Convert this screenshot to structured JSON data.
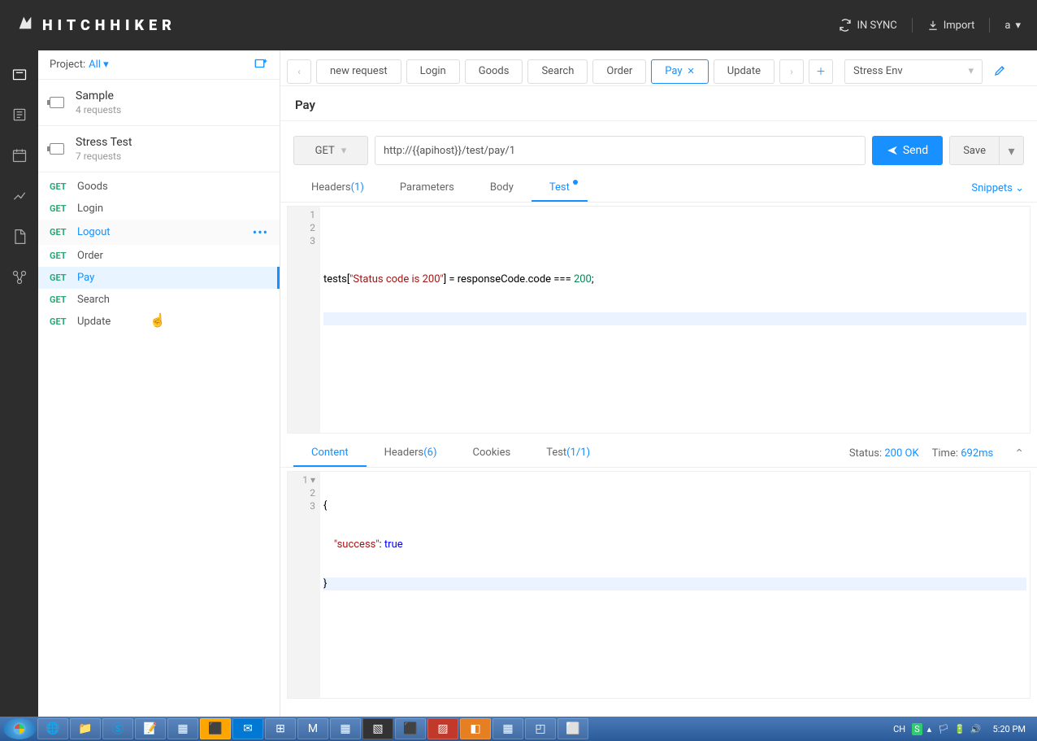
{
  "header": {
    "brand": "HITCHHIKER",
    "sync": "IN SYNC",
    "import": "Import",
    "user": "a"
  },
  "sidebar": {
    "project_label": "Project:",
    "project_value": "All",
    "collections": [
      {
        "name": "Sample",
        "count": "4 requests"
      },
      {
        "name": "Stress Test",
        "count": "7 requests"
      }
    ],
    "requests": [
      {
        "method": "GET",
        "name": "Goods"
      },
      {
        "method": "GET",
        "name": "Login"
      },
      {
        "method": "GET",
        "name": "Logout",
        "hovered": true
      },
      {
        "method": "GET",
        "name": "Order"
      },
      {
        "method": "GET",
        "name": "Pay",
        "active": true
      },
      {
        "method": "GET",
        "name": "Search"
      },
      {
        "method": "GET",
        "name": "Update"
      }
    ]
  },
  "tabs": {
    "items": [
      {
        "label": "new request"
      },
      {
        "label": "Login"
      },
      {
        "label": "Goods"
      },
      {
        "label": "Search"
      },
      {
        "label": "Order"
      },
      {
        "label": "Pay",
        "active": true,
        "closable": true
      },
      {
        "label": "Update"
      }
    ],
    "env": "Stress Env"
  },
  "request": {
    "title": "Pay",
    "method": "GET",
    "url": "http://{{apihost}}/test/pay/1",
    "send": "Send",
    "save": "Save",
    "sub_tabs": {
      "headers": "Headers",
      "headers_count": "(1)",
      "parameters": "Parameters",
      "body": "Body",
      "test": "Test"
    },
    "snippets": "Snippets",
    "test_code": {
      "l1": "tests[",
      "l1s": "\"Status code is 200\"",
      "l1e": "] = responseCode.code === ",
      "l1n": "200",
      "l1end": ";"
    }
  },
  "response": {
    "tabs": {
      "content": "Content",
      "headers": "Headers",
      "headers_count": "(6)",
      "cookies": "Cookies",
      "test": "Test",
      "test_count": "(1/1)"
    },
    "status_label": "Status:",
    "status_value": "200 OK",
    "time_label": "Time:",
    "time_value": "692ms",
    "body": {
      "l1": "{",
      "l2k": "\"success\"",
      "l2c": ": ",
      "l2v": "true",
      "l3": "}"
    }
  },
  "taskbar": {
    "clock": "5:20 PM",
    "lang": "CH"
  }
}
